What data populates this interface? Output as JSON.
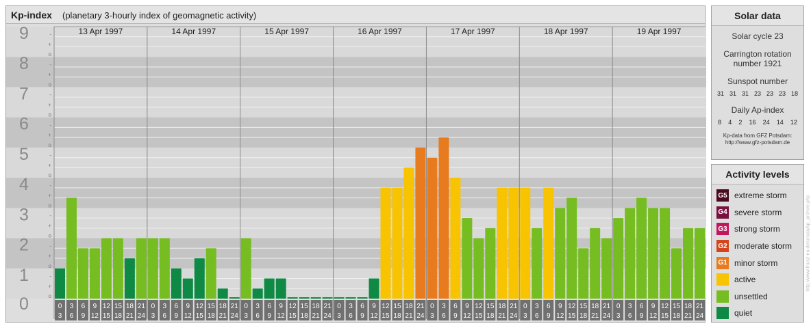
{
  "title": {
    "main": "Kp-index",
    "subtitle": "(planetary 3-hourly index of geomagnetic activity)"
  },
  "chart_data": {
    "type": "bar",
    "ylim": [
      0,
      9
    ],
    "y_ticks": [
      "0",
      "1",
      "2",
      "3",
      "4",
      "5",
      "6",
      "7",
      "8",
      "9"
    ],
    "minor_tick_labels": [
      "+",
      "-",
      "o"
    ],
    "days": [
      "13 Apr 1997",
      "14 Apr 1997",
      "15 Apr 1997",
      "16 Apr 1997",
      "17 Apr 1997",
      "18 Apr 1997",
      "19 Apr 1997"
    ],
    "hour_labels": [
      [
        "0",
        "3"
      ],
      [
        "3",
        "6"
      ],
      [
        "6",
        "9"
      ],
      [
        "9",
        "12"
      ],
      [
        "12",
        "15"
      ],
      [
        "15",
        "18"
      ],
      [
        "18",
        "21"
      ],
      [
        "21",
        "24"
      ]
    ],
    "values": [
      1.0,
      3.333,
      1.667,
      1.667,
      2.0,
      2.0,
      1.333,
      2.0,
      2.0,
      2.0,
      1.0,
      0.667,
      1.333,
      1.667,
      0.333,
      0.0,
      2.0,
      0.333,
      0.667,
      0.667,
      0.0,
      0.0,
      0.0,
      0.0,
      0.0,
      0.0,
      0.0,
      0.667,
      3.667,
      3.667,
      4.333,
      5.0,
      4.667,
      5.333,
      4.0,
      2.667,
      2.0,
      2.333,
      3.667,
      3.667,
      3.667,
      2.333,
      3.667,
      3.0,
      3.333,
      1.667,
      2.333,
      2.0,
      2.667,
      3.0,
      3.333,
      3.0,
      3.0,
      1.667,
      2.333,
      2.333
    ]
  },
  "colors": {
    "quiet": "#0e8a45",
    "unsettled": "#76bd22",
    "active": "#f8c300",
    "minor_storm": "#e87b1e",
    "moderate_storm": "#d4451d",
    "strong_storm": "#c2185b",
    "severe_storm": "#7a1040",
    "extreme_storm": "#4a0a1f",
    "band_dark": "#c4c4c4",
    "band_light": "#d9d9d9",
    "axis_label": "#8a8a8a",
    "hour_label_bg": "#707070"
  },
  "solar": {
    "header": "Solar data",
    "cycle": "Solar cycle 23",
    "rotation_line1": "Carrington rotation",
    "rotation_line2": "number 1921",
    "sunspot_label": "Sunspot number",
    "sunspot_values": [
      "31",
      "31",
      "31",
      "23",
      "23",
      "23",
      "18"
    ],
    "ap_label": "Daily Ap-index",
    "ap_values": [
      "8",
      "4",
      "2",
      "16",
      "24",
      "14",
      "12"
    ],
    "credit_line1": "Kp-data from GFZ Potsdam:",
    "credit_line2": "http://www.gfz-potsdam.de"
  },
  "activity": {
    "header": "Activity levels",
    "levels": [
      {
        "code": "G5",
        "label": "extreme storm",
        "color": "#4a0a1f"
      },
      {
        "code": "G4",
        "label": "severe storm",
        "color": "#7a1040"
      },
      {
        "code": "G3",
        "label": "strong storm",
        "color": "#c2185b"
      },
      {
        "code": "G2",
        "label": "moderate storm",
        "color": "#d4451d"
      },
      {
        "code": "G1",
        "label": "minor storm",
        "color": "#e87b1e"
      },
      {
        "code": "",
        "label": "active",
        "color": "#f8c300"
      },
      {
        "code": "",
        "label": "unsettled",
        "color": "#76bd22"
      },
      {
        "code": "",
        "label": "quiet",
        "color": "#0e8a45"
      }
    ]
  },
  "watermark": "http://www.fnusz-eu.de/ursula/kp_archive.php"
}
